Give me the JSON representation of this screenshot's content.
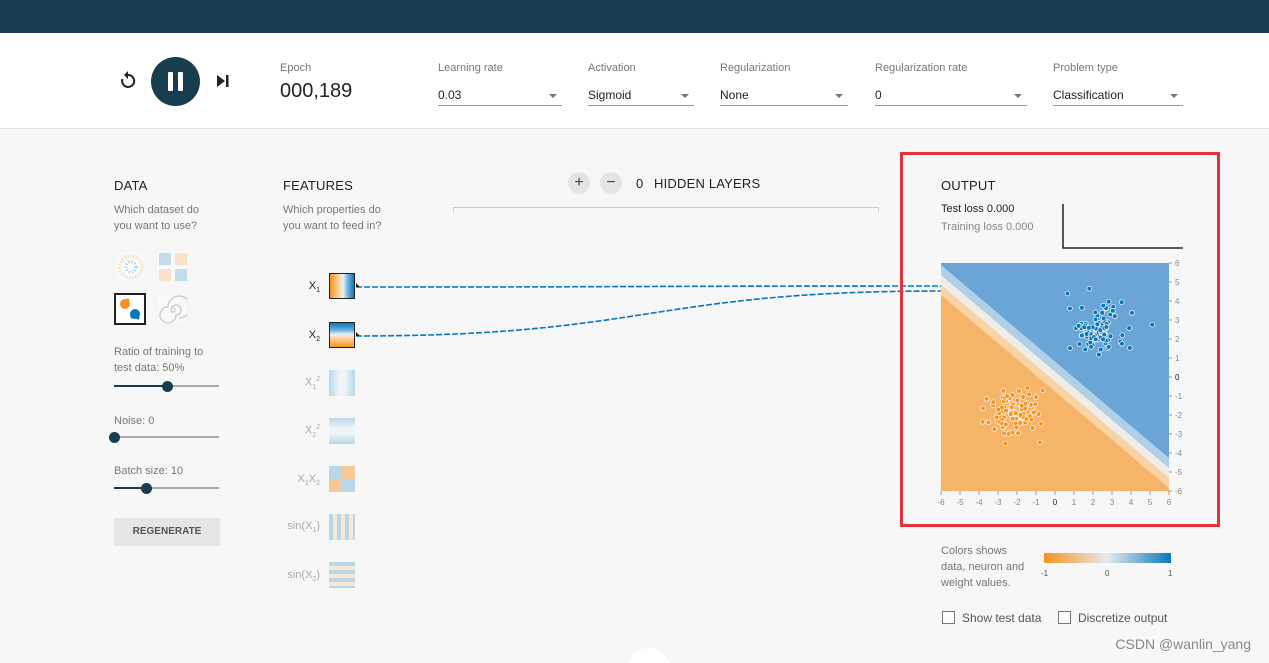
{
  "controls": {
    "epoch_label": "Epoch",
    "epoch_value": "000,189",
    "learning_rate": {
      "label": "Learning rate",
      "value": "0.03"
    },
    "activation": {
      "label": "Activation",
      "value": "Sigmoid"
    },
    "regularization": {
      "label": "Regularization",
      "value": "None"
    },
    "regularization_rate": {
      "label": "Regularization rate",
      "value": "0"
    },
    "problem_type": {
      "label": "Problem type",
      "value": "Classification"
    }
  },
  "data_panel": {
    "title": "DATA",
    "subtitle1": "Which dataset do",
    "subtitle2": "you want to use?",
    "ratio_label1": "Ratio of training to",
    "ratio_label2": "test data:  50%",
    "ratio_value": 0.5,
    "noise_label": "Noise:  0",
    "noise_value": 0.0,
    "batch_label": "Batch size:  10",
    "batch_value": 0.3,
    "regenerate": "REGENERATE"
  },
  "features_panel": {
    "title": "FEATURES",
    "subtitle1": "Which properties do",
    "subtitle2": "you want to feed in?",
    "features": [
      {
        "base": "X",
        "sub": "1",
        "sup": ""
      },
      {
        "base": "X",
        "sub": "2",
        "sup": ""
      },
      {
        "base": "X",
        "sub": "1",
        "sup": "2"
      },
      {
        "base": "X",
        "sub": "2",
        "sup": "2"
      },
      {
        "base": "X",
        "sub": "1",
        "sup": "",
        "base2": "X",
        "sub2": "2"
      },
      {
        "base": "sin(X",
        "sub": "1",
        "sup": "",
        "tail": ")"
      },
      {
        "base": "sin(X",
        "sub": "2",
        "sup": "",
        "tail": ")"
      }
    ]
  },
  "network": {
    "layer_count": "0",
    "hidden_layers_label": "HIDDEN LAYERS",
    "add_label": "+",
    "remove_label": "−"
  },
  "output_panel": {
    "title": "OUTPUT",
    "test_loss": "Test loss 0.000",
    "training_loss": "Training loss 0.000",
    "x_ticks": [
      "-6",
      "-5",
      "-4",
      "-3",
      "-2",
      "-1",
      "0",
      "1",
      "2",
      "3",
      "4",
      "5",
      "6"
    ],
    "y_ticks": [
      "6",
      "5",
      "4",
      "3",
      "2",
      "1",
      "0",
      "-1",
      "-2",
      "-3",
      "-4",
      "-5",
      "-6"
    ],
    "legend_text1": "Colors shows",
    "legend_text2": "data, neuron and",
    "legend_text3": "weight values.",
    "legend_min": "-1",
    "legend_mid": "0",
    "legend_max": "1",
    "show_test_data": "Show test data",
    "discretize_output": "Discretize output"
  },
  "colors": {
    "accent": "#183d4e",
    "orange": "#f59322",
    "blue": "#0877bd",
    "highlight": "#e8303a"
  },
  "watermark": "CSDN @wanlin_yang"
}
